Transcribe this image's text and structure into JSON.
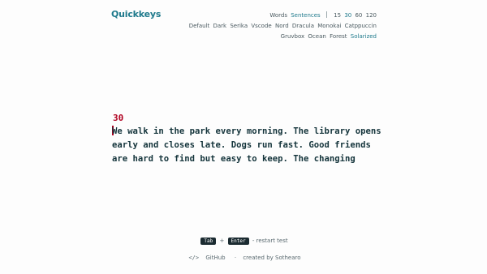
{
  "app": {
    "title": "Quickkeys"
  },
  "menu": {
    "modes": [
      "Words",
      "Sentences"
    ],
    "active_mode": "Sentences",
    "durations": [
      "15",
      "30",
      "60",
      "120"
    ],
    "active_duration": "30",
    "themes_row1": [
      "Default",
      "Dark",
      "Serika",
      "Vscode",
      "Nord",
      "Dracula",
      "Monokai",
      "Catppuccin"
    ],
    "themes_row2": [
      "Gruvbox",
      "Ocean",
      "Forest",
      "Solarized"
    ],
    "active_theme": "Solarized"
  },
  "test": {
    "timer": "30",
    "lines": [
      "We walk in the park every morning. The library opens",
      "early and closes late. Dogs run fast. Good friends",
      "are hard to find but easy to keep. The changing"
    ]
  },
  "footer": {
    "key1": "Tab",
    "plus": "+",
    "key2": "Enter",
    "dash": "-",
    "action": "restart test",
    "github_icon": "</>",
    "github_label": "GitHub",
    "dot": "·",
    "credit": "created by Sothearo"
  },
  "colors": {
    "accent": "#1f7a8c",
    "error": "#b00020",
    "text": "#14343b"
  }
}
